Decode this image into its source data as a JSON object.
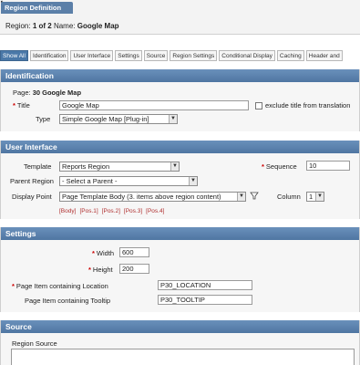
{
  "header": {
    "tab_label": "Region Definition",
    "region_label": "Region:",
    "region_value": "1 of 2",
    "name_label": "Name:",
    "name_value": "Google Map"
  },
  "tabs": [
    "Show All",
    "Identification",
    "User Interface",
    "Settings",
    "Source",
    "Region Settings",
    "Conditional Display",
    "Caching",
    "Header and"
  ],
  "identification": {
    "heading": "Identification",
    "page_label": "Page:",
    "page_value": "30 Google Map",
    "title_label": "Title",
    "title_value": "Google Map",
    "exclude_label": "exclude title from translation",
    "type_label": "Type",
    "type_value": "Simple Google Map [Plug-in]"
  },
  "user_interface": {
    "heading": "User Interface",
    "template_label": "Template",
    "template_value": "Reports Region",
    "sequence_label": "Sequence",
    "sequence_value": "10",
    "parent_label": "Parent Region",
    "parent_value": "- Select a Parent -",
    "display_label": "Display Point",
    "display_value": "Page Template Body (3. items above region content)",
    "column_label": "Column",
    "column_value": "1",
    "positions": [
      "[Body]",
      "[Pos.1]",
      "[Pos.2]",
      "[Pos.3]",
      "[Pos.4]"
    ]
  },
  "settings": {
    "heading": "Settings",
    "width_label": "Width",
    "width_value": "600",
    "height_label": "Height",
    "height_value": "200",
    "location_label": "Page Item containing Location",
    "location_value": "P30_LOCATION",
    "tooltip_label": "Page Item containing Tooltip",
    "tooltip_value": "P30_TOOLTIP"
  },
  "source": {
    "heading": "Source",
    "region_source_label": "Region Source"
  }
}
